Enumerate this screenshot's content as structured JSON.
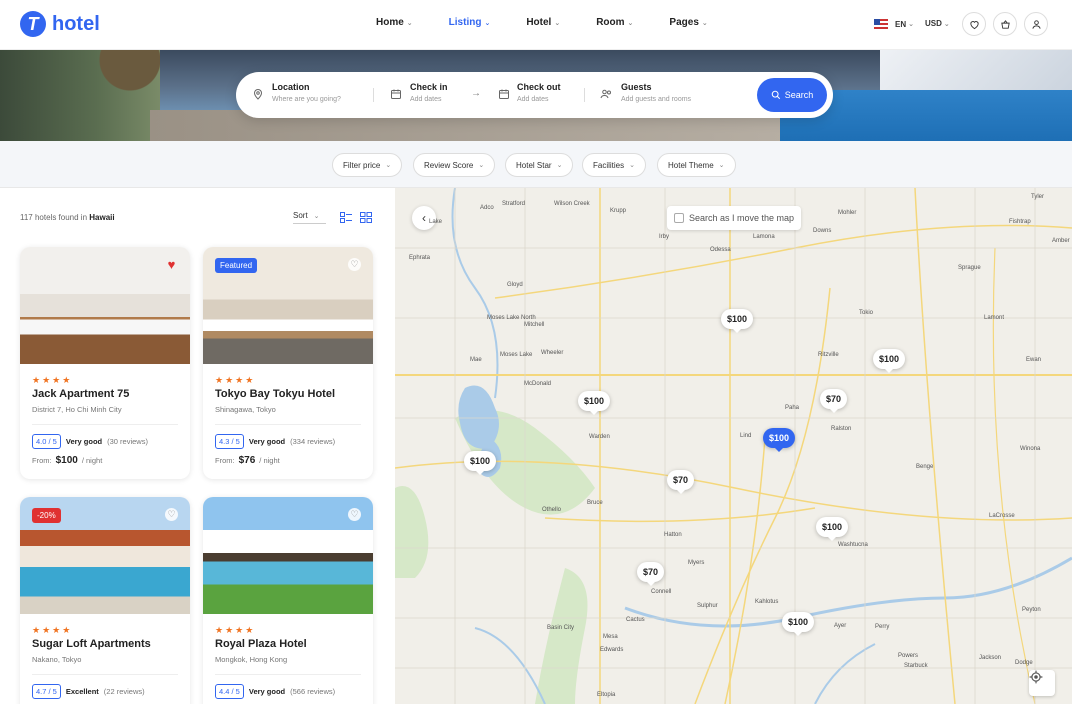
{
  "brand": {
    "mark": "T",
    "name": "hotel"
  },
  "nav": [
    {
      "label": "Home",
      "active": false
    },
    {
      "label": "Listing",
      "active": true
    },
    {
      "label": "Hotel",
      "active": false
    },
    {
      "label": "Room",
      "active": false
    },
    {
      "label": "Pages",
      "active": false
    }
  ],
  "tools": {
    "language": "EN",
    "currency": "USD"
  },
  "search": {
    "location_label": "Location",
    "location_placeholder": "Where are you going?",
    "checkin_label": "Check in",
    "checkin_placeholder": "Add dates",
    "checkout_label": "Check out",
    "checkout_placeholder": "Add dates",
    "guests_label": "Guests",
    "guests_placeholder": "Add guests and rooms",
    "button": "Search"
  },
  "filters": [
    "Filter price",
    "Review Score",
    "Hotel Star",
    "Facilities",
    "Hotel Theme"
  ],
  "results": {
    "count_text": "117 hotels found in",
    "place": "Hawaii",
    "sort_label": "Sort"
  },
  "hotels": [
    {
      "name": "Jack Apartment 75",
      "location": "District 7, Ho Chi Minh City",
      "score": "4.0 / 5",
      "verdict": "Very good",
      "reviews": "(30 reviews)",
      "from": "From:",
      "price": "$100",
      "per": "/ night",
      "stars": "★★★★",
      "badge": "",
      "favorite": true
    },
    {
      "name": "Tokyo Bay Tokyu Hotel",
      "location": "Shinagawa, Tokyo",
      "score": "4.3 / 5",
      "verdict": "Very good",
      "reviews": "(334 reviews)",
      "from": "From:",
      "price": "$76",
      "per": "/ night",
      "stars": "★★★★",
      "badge": "Featured",
      "favorite": false
    },
    {
      "name": "Sugar Loft Apartments",
      "location": "Nakano, Tokyo",
      "score": "4.7 / 5",
      "verdict": "Excellent",
      "reviews": "(22 reviews)",
      "stars": "★★★★",
      "badge": "-20%",
      "favorite": false
    },
    {
      "name": "Royal Plaza Hotel",
      "location": "Mongkok, Hong Kong",
      "score": "4.4 / 5",
      "verdict": "Very good",
      "reviews": "(566 reviews)",
      "stars": "★★★★",
      "badge": "",
      "favorite": false
    }
  ],
  "map": {
    "checkbox_label": "Search as I move the map",
    "pins": [
      "$100",
      "$100",
      "$100",
      "$70",
      "$100",
      "$100",
      "$70",
      "$100",
      "$70",
      "$100"
    ],
    "towns": [
      "Stratford",
      "Wilson Creek",
      "Krupp",
      "Mohler",
      "Tyler",
      "Adco",
      "Lake",
      "Irby",
      "Odessa",
      "Lamona",
      "Downs",
      "Fishtrap",
      "Ephrata",
      "Amber",
      "Sprague",
      "Gloyd",
      "Moses Lake North",
      "Mitchell",
      "Tokio",
      "Lamont",
      "Mae",
      "Moses Lake",
      "Wheeler",
      "Ritzville",
      "Ewan",
      "McDonald",
      "Paha",
      "Ralston",
      "Warden",
      "Lind",
      "Benge",
      "Winona",
      "Bruce",
      "Othello",
      "Hatton",
      "LaCrosse",
      "Washtucna",
      "Myers",
      "Connell",
      "Sulphur",
      "Kahlotus",
      "Peyton",
      "Basin City",
      "Cactus",
      "Mesa",
      "Ayer",
      "Perry",
      "Edwards",
      "Powers",
      "Starbuck",
      "Jackson",
      "Dodge",
      "Eltopia"
    ]
  },
  "colors": {
    "accent": "#3266f0",
    "star": "#f07422",
    "favorite": "#e03131"
  }
}
